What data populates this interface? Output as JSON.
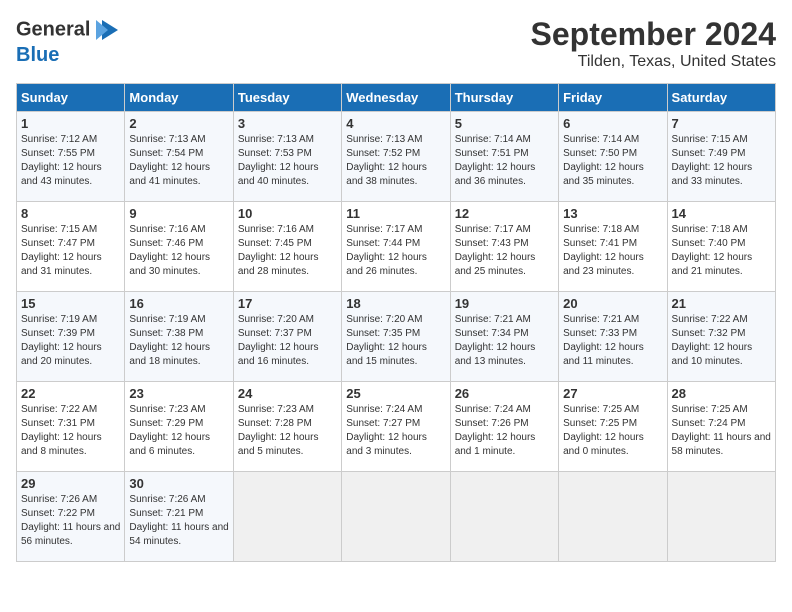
{
  "logo": {
    "text_general": "General",
    "text_blue": "Blue"
  },
  "header": {
    "month": "September 2024",
    "location": "Tilden, Texas, United States"
  },
  "weekdays": [
    "Sunday",
    "Monday",
    "Tuesday",
    "Wednesday",
    "Thursday",
    "Friday",
    "Saturday"
  ],
  "weeks": [
    [
      {
        "day": "1",
        "sunrise": "7:12 AM",
        "sunset": "7:55 PM",
        "daylight": "12 hours and 43 minutes."
      },
      {
        "day": "2",
        "sunrise": "7:13 AM",
        "sunset": "7:54 PM",
        "daylight": "12 hours and 41 minutes."
      },
      {
        "day": "3",
        "sunrise": "7:13 AM",
        "sunset": "7:53 PM",
        "daylight": "12 hours and 40 minutes."
      },
      {
        "day": "4",
        "sunrise": "7:13 AM",
        "sunset": "7:52 PM",
        "daylight": "12 hours and 38 minutes."
      },
      {
        "day": "5",
        "sunrise": "7:14 AM",
        "sunset": "7:51 PM",
        "daylight": "12 hours and 36 minutes."
      },
      {
        "day": "6",
        "sunrise": "7:14 AM",
        "sunset": "7:50 PM",
        "daylight": "12 hours and 35 minutes."
      },
      {
        "day": "7",
        "sunrise": "7:15 AM",
        "sunset": "7:49 PM",
        "daylight": "12 hours and 33 minutes."
      }
    ],
    [
      {
        "day": "8",
        "sunrise": "7:15 AM",
        "sunset": "7:47 PM",
        "daylight": "12 hours and 31 minutes."
      },
      {
        "day": "9",
        "sunrise": "7:16 AM",
        "sunset": "7:46 PM",
        "daylight": "12 hours and 30 minutes."
      },
      {
        "day": "10",
        "sunrise": "7:16 AM",
        "sunset": "7:45 PM",
        "daylight": "12 hours and 28 minutes."
      },
      {
        "day": "11",
        "sunrise": "7:17 AM",
        "sunset": "7:44 PM",
        "daylight": "12 hours and 26 minutes."
      },
      {
        "day": "12",
        "sunrise": "7:17 AM",
        "sunset": "7:43 PM",
        "daylight": "12 hours and 25 minutes."
      },
      {
        "day": "13",
        "sunrise": "7:18 AM",
        "sunset": "7:41 PM",
        "daylight": "12 hours and 23 minutes."
      },
      {
        "day": "14",
        "sunrise": "7:18 AM",
        "sunset": "7:40 PM",
        "daylight": "12 hours and 21 minutes."
      }
    ],
    [
      {
        "day": "15",
        "sunrise": "7:19 AM",
        "sunset": "7:39 PM",
        "daylight": "12 hours and 20 minutes."
      },
      {
        "day": "16",
        "sunrise": "7:19 AM",
        "sunset": "7:38 PM",
        "daylight": "12 hours and 18 minutes."
      },
      {
        "day": "17",
        "sunrise": "7:20 AM",
        "sunset": "7:37 PM",
        "daylight": "12 hours and 16 minutes."
      },
      {
        "day": "18",
        "sunrise": "7:20 AM",
        "sunset": "7:35 PM",
        "daylight": "12 hours and 15 minutes."
      },
      {
        "day": "19",
        "sunrise": "7:21 AM",
        "sunset": "7:34 PM",
        "daylight": "12 hours and 13 minutes."
      },
      {
        "day": "20",
        "sunrise": "7:21 AM",
        "sunset": "7:33 PM",
        "daylight": "12 hours and 11 minutes."
      },
      {
        "day": "21",
        "sunrise": "7:22 AM",
        "sunset": "7:32 PM",
        "daylight": "12 hours and 10 minutes."
      }
    ],
    [
      {
        "day": "22",
        "sunrise": "7:22 AM",
        "sunset": "7:31 PM",
        "daylight": "12 hours and 8 minutes."
      },
      {
        "day": "23",
        "sunrise": "7:23 AM",
        "sunset": "7:29 PM",
        "daylight": "12 hours and 6 minutes."
      },
      {
        "day": "24",
        "sunrise": "7:23 AM",
        "sunset": "7:28 PM",
        "daylight": "12 hours and 5 minutes."
      },
      {
        "day": "25",
        "sunrise": "7:24 AM",
        "sunset": "7:27 PM",
        "daylight": "12 hours and 3 minutes."
      },
      {
        "day": "26",
        "sunrise": "7:24 AM",
        "sunset": "7:26 PM",
        "daylight": "12 hours and 1 minute."
      },
      {
        "day": "27",
        "sunrise": "7:25 AM",
        "sunset": "7:25 PM",
        "daylight": "12 hours and 0 minutes."
      },
      {
        "day": "28",
        "sunrise": "7:25 AM",
        "sunset": "7:24 PM",
        "daylight": "11 hours and 58 minutes."
      }
    ],
    [
      {
        "day": "29",
        "sunrise": "7:26 AM",
        "sunset": "7:22 PM",
        "daylight": "11 hours and 56 minutes."
      },
      {
        "day": "30",
        "sunrise": "7:26 AM",
        "sunset": "7:21 PM",
        "daylight": "11 hours and 54 minutes."
      },
      null,
      null,
      null,
      null,
      null
    ]
  ]
}
